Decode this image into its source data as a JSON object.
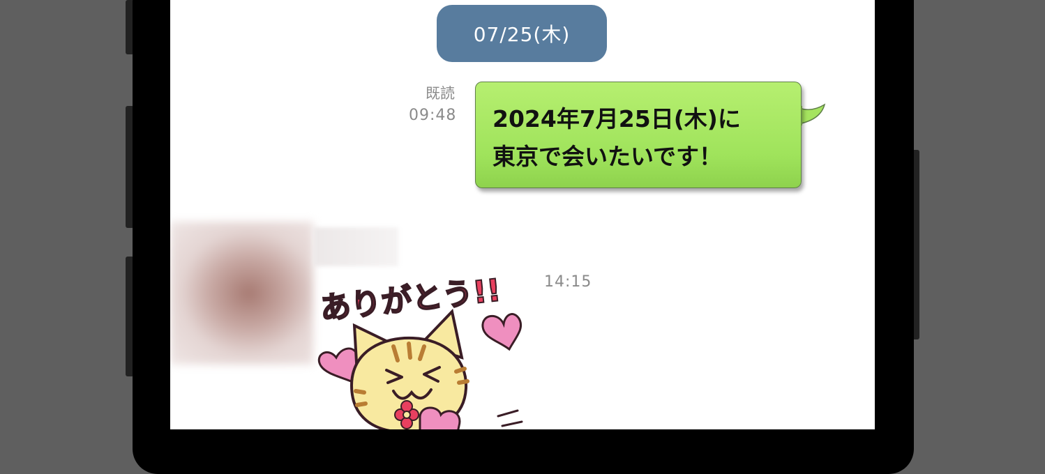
{
  "date_divider": "07/25(木)",
  "outgoing": {
    "read_label": "既読",
    "time": "09:48",
    "text": "2024年7月25日(木)に\n東京で会いたいです！"
  },
  "incoming": {
    "time": "14:15",
    "sticker_text": "ありがとう!!"
  },
  "colors": {
    "date_pill": "#587c9e",
    "bubble_green": "#9fe35b",
    "heart_pink": "#ef8fbf",
    "sticker_text": "#e8405f"
  }
}
